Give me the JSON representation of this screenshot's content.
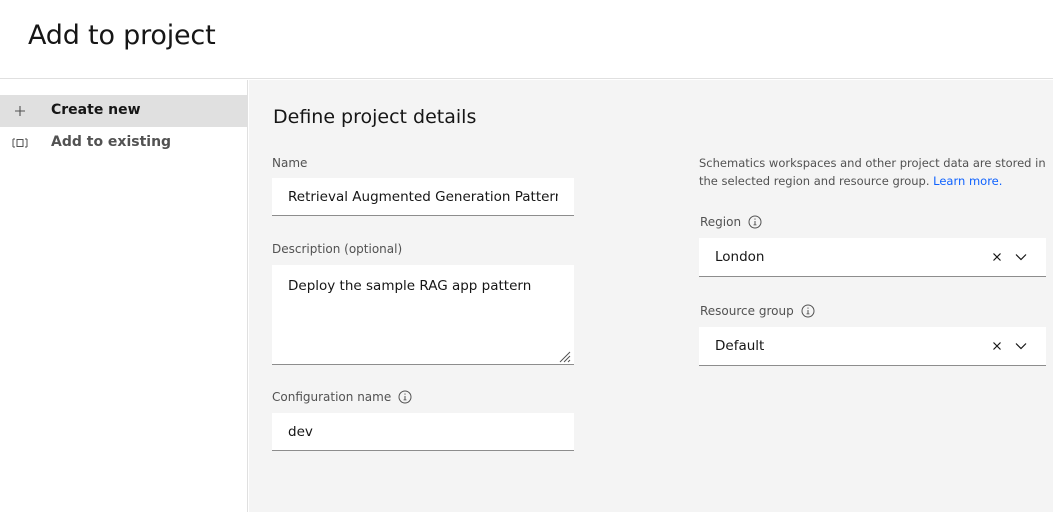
{
  "header": {
    "title": "Add to project"
  },
  "sidebar": {
    "items": [
      {
        "label": "Create new",
        "icon": "plus-icon",
        "active": true
      },
      {
        "label": "Add to existing",
        "icon": "folder-add-icon",
        "active": false
      }
    ]
  },
  "form": {
    "section_title": "Define project details",
    "name": {
      "label": "Name",
      "value": "Retrieval Augmented Generation Pattern"
    },
    "description": {
      "label": "Description (optional)",
      "value": "Deploy the sample RAG app pattern"
    },
    "config_name": {
      "label": "Configuration name",
      "value": "dev"
    },
    "helper": {
      "text": "Schematics workspaces and other project data are stored in the selected region and resource group.",
      "link_text": "Learn more."
    },
    "region": {
      "label": "Region",
      "value": "London"
    },
    "resource_group": {
      "label": "Resource group",
      "value": "Default"
    }
  },
  "colors": {
    "link": "#0f62fe",
    "panel_background": "#f4f4f4",
    "active_nav_background": "#e0e0e0"
  }
}
